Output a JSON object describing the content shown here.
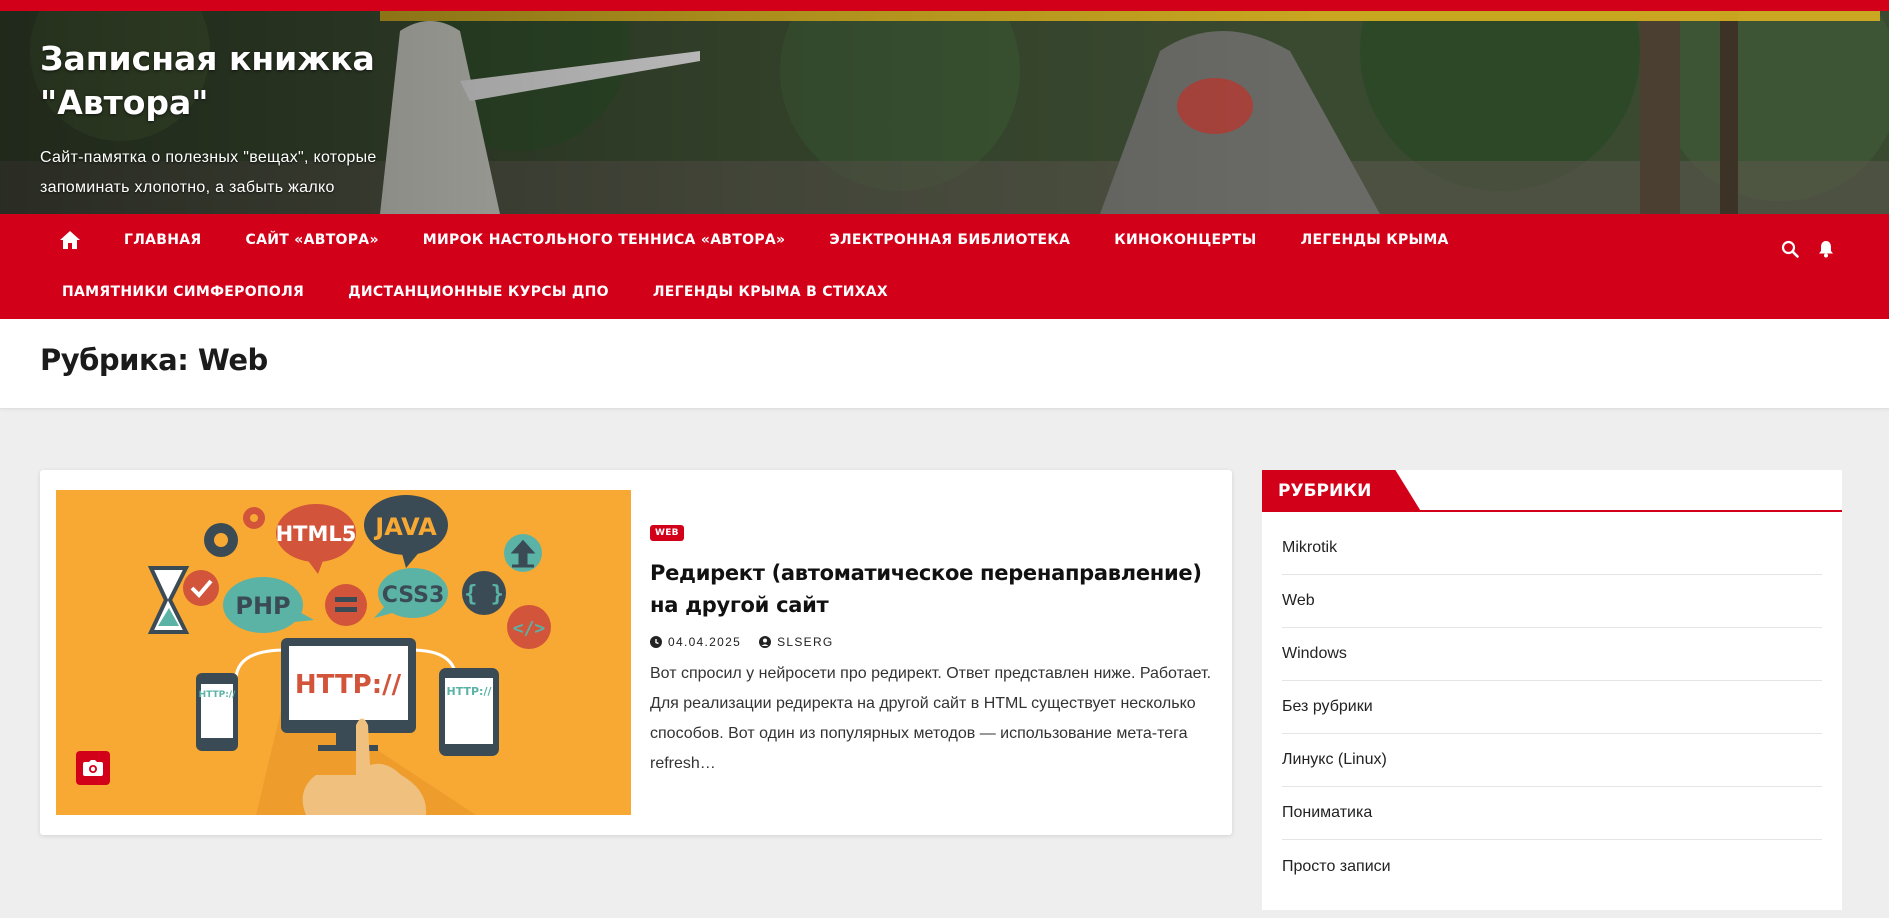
{
  "site": {
    "title": "Записная книжка \"Автора\"",
    "tagline": "Сайт-памятка о полезных \"вещах\", которые запоминать хлопотно, а забыть жалко"
  },
  "colors": {
    "accent": "#d3001a",
    "thumb_bg": "#f7a934"
  },
  "nav": {
    "home_icon": "home-icon",
    "items": [
      "Главная",
      "Сайт «Автора»",
      "Мирок настольного тенниса «Автора»",
      "Электронная библиотека",
      "Киноконцерты",
      "Легенды Крыма",
      "Памятники Симферополя",
      "Дистанционные курсы ДПО",
      "Легенды Крыма в стихах"
    ],
    "icons": [
      "search-icon",
      "bell-icon"
    ]
  },
  "page": {
    "title": "Рубрика: Web"
  },
  "post": {
    "category": "Web",
    "title": "Редирект (автоматическое перенаправление) на другой сайт",
    "date": "04.04.2025",
    "author": "SLSERG",
    "excerpt": "Вот спросил у нейросети про редирект. Ответ представлен ниже. Работает. Для реализации редиректа на другой сайт в HTML существует несколько способов. Вот один из популярных методов — использование мета-тега refresh…",
    "thumb_labels": {
      "html": "HTML5",
      "java": "JAVA",
      "php": "PHP",
      "css": "CSS3",
      "http_main": "HTTP://",
      "http_small": "HTTP://",
      "braces": "{ }",
      "code": "</>"
    }
  },
  "sidebar": {
    "widget_title": "Рубрики",
    "categories": [
      "Mikrotik",
      "Web",
      "Windows",
      "Без рубрики",
      "Линукс (Linux)",
      "Пониматика",
      "Просто записи"
    ]
  }
}
